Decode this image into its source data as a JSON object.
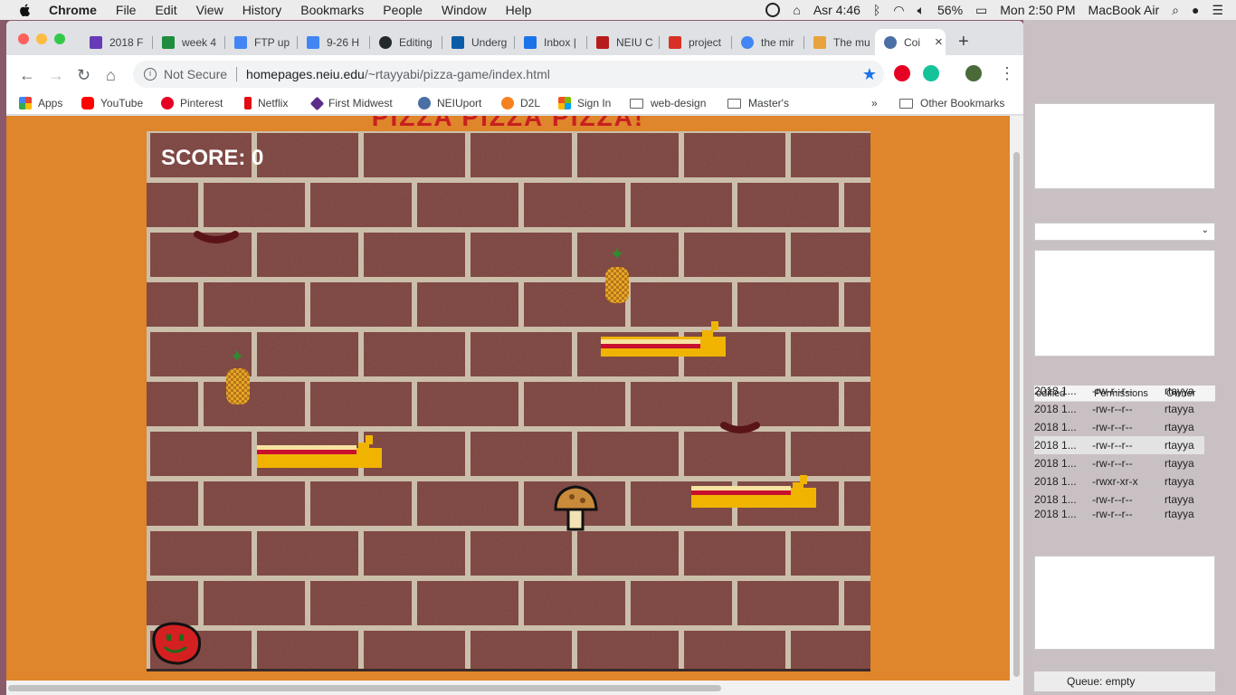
{
  "menubar": {
    "app": "Chrome",
    "items": [
      "File",
      "Edit",
      "View",
      "History",
      "Bookmarks",
      "People",
      "Window",
      "Help"
    ],
    "prayer": "Asr 4:46",
    "battery": "56%",
    "clock": "Mon 2:50 PM",
    "computer": "MacBook Air"
  },
  "tabs": [
    {
      "label": "2018 F",
      "color": "#673ab7"
    },
    {
      "label": "week 4",
      "color": "#1e8e3e"
    },
    {
      "label": "FTP up",
      "color": "#4285f4"
    },
    {
      "label": "9-26 H",
      "color": "#4285f4"
    },
    {
      "label": "Editing",
      "color": "#24292e"
    },
    {
      "label": "Underg",
      "color": "#0b5ca8"
    },
    {
      "label": "Inbox |",
      "color": "#1a73e8"
    },
    {
      "label": "NEIU C",
      "color": "#b71c1c"
    },
    {
      "label": "project",
      "color": "#d93025"
    },
    {
      "label": "the mir",
      "color": "#4285f4"
    },
    {
      "label": "The mu",
      "color": "#e8a33d"
    },
    {
      "label": "Coi",
      "color": "#4a6fa5",
      "active": true
    }
  ],
  "address": {
    "security": "Not Secure",
    "host": "homepages.neiu.edu",
    "path": "/~rtayyabi/pizza-game/index.html"
  },
  "bookmarks": [
    {
      "label": "Apps",
      "icon": "apps-grid-icon"
    },
    {
      "label": "YouTube",
      "icon": "youtube-icon"
    },
    {
      "label": "Pinterest",
      "icon": "pinterest-icon"
    },
    {
      "label": "Netflix",
      "icon": "netflix-icon"
    },
    {
      "label": "First Midwest",
      "icon": "first-midwest-icon"
    },
    {
      "label": "NEIUport",
      "icon": "neiuport-icon"
    },
    {
      "label": "D2L",
      "icon": "d2l-icon"
    },
    {
      "label": "Sign In",
      "icon": "microsoft-icon"
    },
    {
      "label": "web-design",
      "icon": "folder-icon"
    },
    {
      "label": "Master's",
      "icon": "folder-icon"
    }
  ],
  "other_bookmarks": "Other Bookmarks",
  "page": {
    "title": "PIZZA PIZZA PIZZA!",
    "score_label": "SCORE: 0"
  },
  "bgapp": {
    "columns": [
      "odified",
      "Permissions",
      "Owner"
    ],
    "rows": [
      {
        "date": "2018 1...",
        "perm": "-rw-r--r--",
        "owner": "rtayya"
      },
      {
        "date": "2018 1...",
        "perm": "-rw-r--r--",
        "owner": "rtayya"
      },
      {
        "date": "2018 1...",
        "perm": "-rw-r--r--",
        "owner": "rtayya"
      },
      {
        "date": "2018 1...",
        "perm": "-rw-r--r--",
        "owner": "rtayya"
      },
      {
        "date": "2018 1...",
        "perm": "-rw-r--r--",
        "owner": "rtayya"
      },
      {
        "date": "2018 1...",
        "perm": "-rwxr-xr-x",
        "owner": "rtayya"
      },
      {
        "date": "2018 1...",
        "perm": "-rw-r--r--",
        "owner": "rtayya"
      },
      {
        "date": "2018 1...",
        "perm": "-rw-r--r--",
        "owner": "rtayya"
      }
    ],
    "queue": "Queue: empty"
  },
  "colors": {
    "page_bg": "#df852b",
    "brick": "#7a3f3a",
    "mortar": "#cdbfa8",
    "score": "#ffffff",
    "title": "#c82020"
  }
}
